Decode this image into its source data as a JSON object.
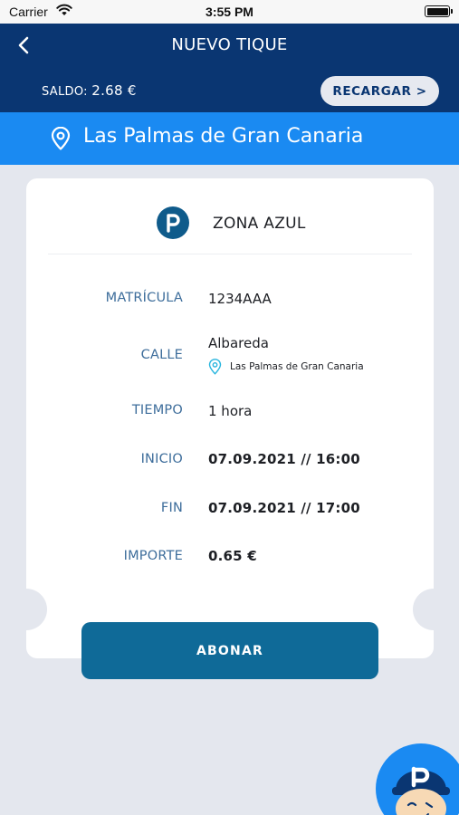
{
  "status_bar": {
    "carrier": "Carrier",
    "time": "3:55 PM"
  },
  "header": {
    "title": "NUEVO TIQUE",
    "balance_label": "SALDO:",
    "balance_amount": "2.68 €",
    "recharge_label": "RECARGAR >"
  },
  "city": {
    "name": "Las Palmas de Gran Canaria"
  },
  "ticket": {
    "zone_name": "ZONA AZUL",
    "plate_label": "MATRÍCULA",
    "plate_value": "1234AAA",
    "street_label": "CALLE",
    "street_value": "Albareda",
    "street_city": "Las Palmas de Gran Canaria",
    "time_label": "TIEMPO",
    "time_value": "1 hora",
    "start_label": "INICIO",
    "start_value": "07.09.2021 // 16:00",
    "end_label": "FIN",
    "end_value": "07.09.2021 // 17:00",
    "amount_label": "IMPORTE",
    "amount_value": "0.65 €"
  },
  "actions": {
    "pay_label": "ABONAR"
  },
  "colors": {
    "header_bg": "#0a3672",
    "city_bar_bg": "#1a8af2",
    "label_color": "#3d6d9b",
    "button_bg": "#0f6a98",
    "page_bg": "#e4e7ee"
  },
  "icons": {
    "back": "chevron-left-icon",
    "location": "location-pin-icon",
    "zone": "parking-icon",
    "mascot": "mascot-avatar-icon"
  }
}
